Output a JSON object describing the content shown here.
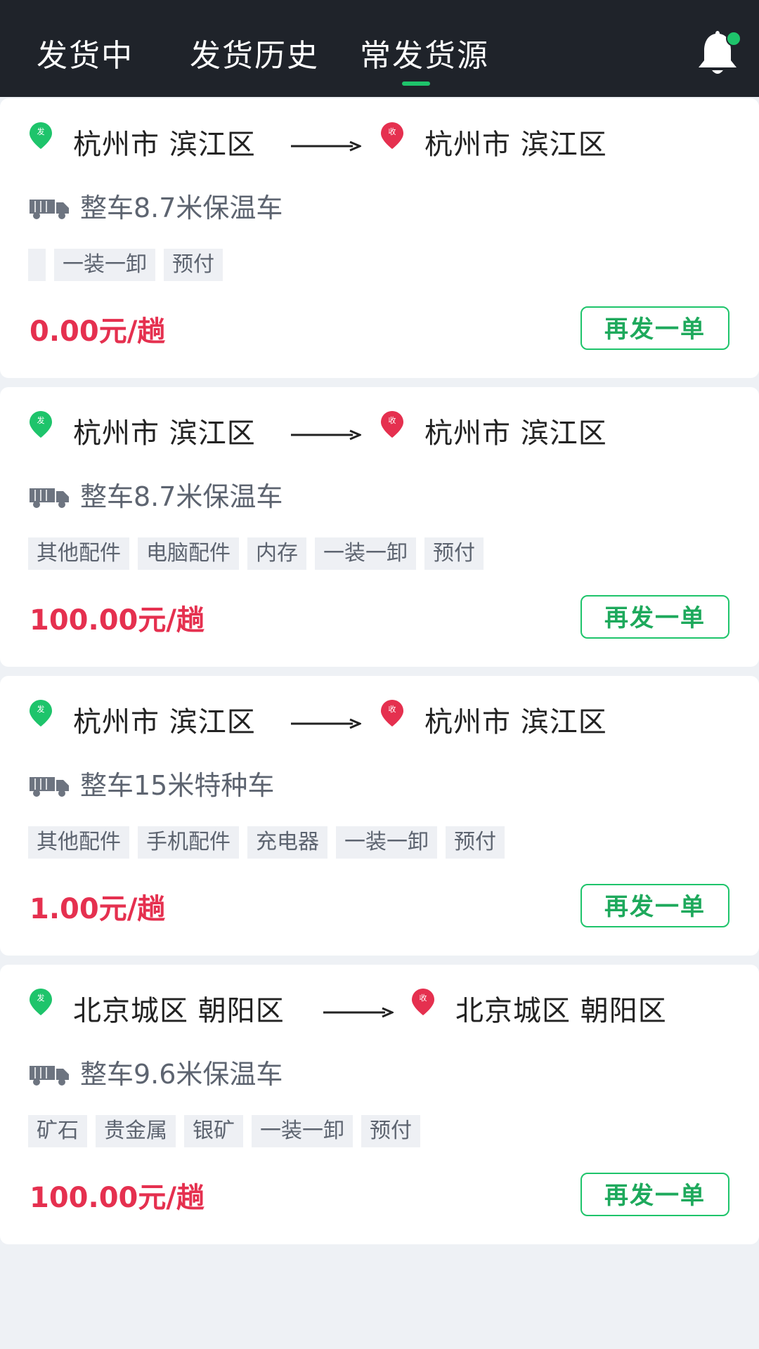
{
  "tabs": [
    "发货中",
    "发货历史",
    "常发货源"
  ],
  "active_tab": 2,
  "icons": {
    "notification": "bell-icon",
    "vehicle": "truck-icon",
    "origin": "green-pin-icon",
    "destination": "red-pin-icon",
    "route": "arrow-right-icon"
  },
  "colors": {
    "header_bg": "#1f232a",
    "accent_green": "#1ec46b",
    "price_red": "#e5304f",
    "page_bg": "#eef1f5"
  },
  "pins": {
    "origin_char": "发",
    "dest_char": "收"
  },
  "cards": [
    {
      "from": "杭州市 滨江区",
      "to": "杭州市 滨江区",
      "vehicle": "整车8.7米保温车",
      "tags": [
        "",
        "一装一卸",
        "预付"
      ],
      "price": "0.00元/趟",
      "action": "再发一单"
    },
    {
      "from": "杭州市 滨江区",
      "to": "杭州市 滨江区",
      "vehicle": "整车8.7米保温车",
      "tags": [
        "其他配件",
        "电脑配件",
        "内存",
        "一装一卸",
        "预付"
      ],
      "price": "100.00元/趟",
      "action": "再发一单"
    },
    {
      "from": "杭州市 滨江区",
      "to": "杭州市 滨江区",
      "vehicle": "整车15米特种车",
      "tags": [
        "其他配件",
        "手机配件",
        "充电器",
        "一装一卸",
        "预付"
      ],
      "price": "1.00元/趟",
      "action": "再发一单"
    },
    {
      "from": "北京城区 朝阳区",
      "to": "北京城区 朝阳区",
      "vehicle": "整车9.6米保温车",
      "tags": [
        "矿石",
        "贵金属",
        "银矿",
        "一装一卸",
        "预付"
      ],
      "price": "100.00元/趟",
      "action": "再发一单"
    }
  ]
}
